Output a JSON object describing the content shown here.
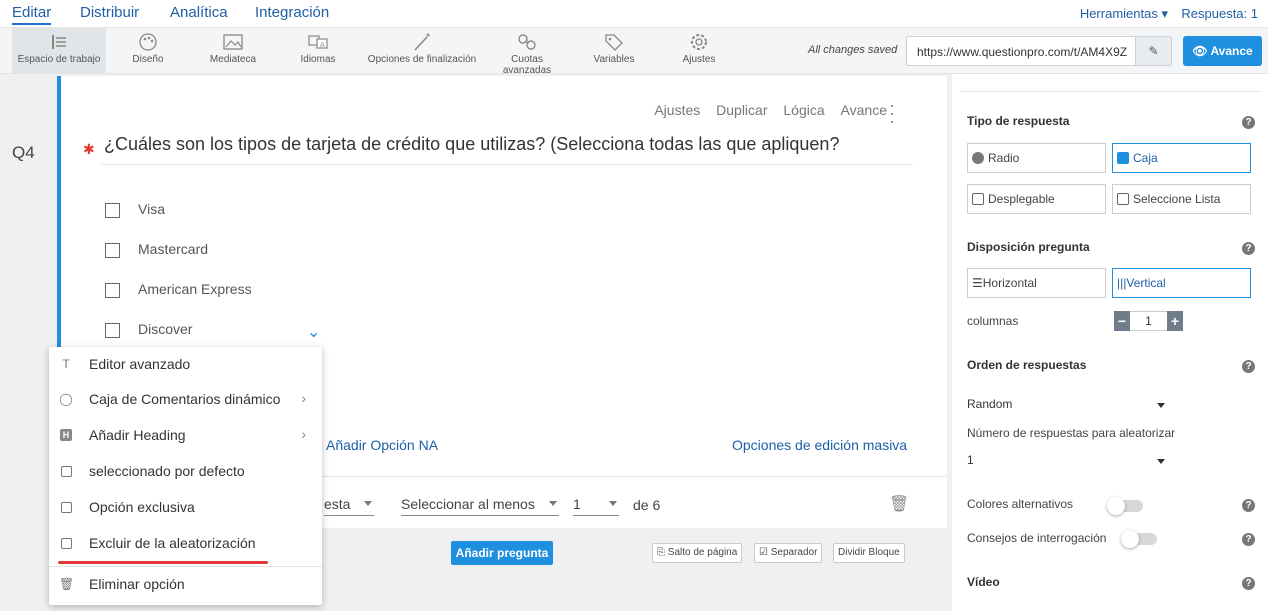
{
  "topnav": {
    "tabs": [
      "Editar",
      "Distribuir",
      "Analítica",
      "Integración"
    ],
    "tools": "Herramientas",
    "responses": "Respuesta: 1"
  },
  "toolbar": {
    "items": [
      {
        "label": "Espacio de trabajo",
        "icon": "workspace-icon"
      },
      {
        "label": "Diseño",
        "icon": "palette-icon"
      },
      {
        "label": "Mediateca",
        "icon": "image-icon"
      },
      {
        "label": "Idiomas",
        "icon": "language-icon"
      },
      {
        "label": "Opciones de finalización",
        "icon": "wand-icon"
      },
      {
        "label": "Cuotas avanzadas",
        "icon": "link-icon"
      },
      {
        "label": "Variables",
        "icon": "tag-icon"
      },
      {
        "label": "Ajustes",
        "icon": "gear-icon"
      }
    ],
    "saved": "All changes saved",
    "url": "https://www.questionpro.com/t/AM4X9Z",
    "preview": "Avance"
  },
  "question": {
    "number": "Q4",
    "actions": [
      "Ajustes",
      "Duplicar",
      "Lógica",
      "Avance"
    ],
    "text": "¿Cuáles son los tipos de tarjeta de crédito que utilizas? (Selecciona todas las que apliquen?",
    "options": [
      "Visa",
      "Mastercard",
      "American Express",
      "Discover"
    ],
    "add_na": "Añadir Opción NA",
    "bulk_edit": "Opciones de edición masiva",
    "answer_type_partial": "esta",
    "validation": "Seleccionar al menos",
    "min_value": "1",
    "of_total": "de 6"
  },
  "below": {
    "add_question": "Añadir pregunta",
    "page_break": "Salto de página",
    "separator": "Separador",
    "split_block": "Dividir Bloque"
  },
  "context_menu": {
    "items": [
      "Editor avanzado",
      "Caja de Comentarios dinámico",
      "Añadir Heading",
      "seleccionado por defecto",
      "Opción exclusiva",
      "Excluir de la aleatorización",
      "Eliminar opción"
    ],
    "heading_icon_letter": "H"
  },
  "right_panel": {
    "answer_type_heading": "Tipo de respuesta",
    "answer_types": [
      "Radio",
      "Caja",
      "Desplegable",
      "Seleccione Lista"
    ],
    "layout_heading": "Disposición pregunta",
    "layouts": [
      "Horizontal",
      "Vertical"
    ],
    "columns_label": "columnas",
    "columns_value": "1",
    "order_heading": "Orden de respuestas",
    "order_value": "Random",
    "randomize_label": "Número de respuestas para aleatorizar",
    "randomize_value": "1",
    "alt_colors": "Colores alternativos",
    "tips": "Consejos de interrogación",
    "video_heading": "Vídeo",
    "help_glyph": "?",
    "accent_color": "#1f8fe0"
  }
}
